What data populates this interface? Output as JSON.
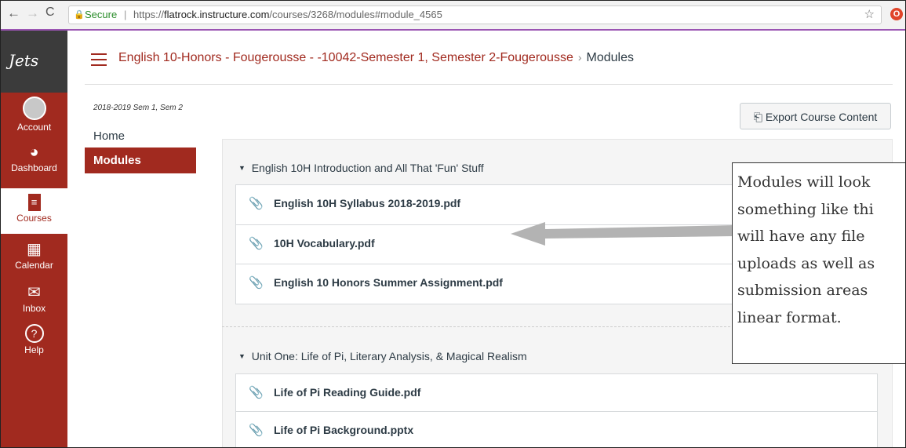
{
  "browser": {
    "secure_label": "Secure",
    "url_prefix": "https://",
    "url_host": "flatrock.instructure.com",
    "url_path": "/courses/3268/modules#module_4565"
  },
  "global_nav": {
    "logo": "Jets",
    "items": [
      {
        "label": "Account",
        "icon": "avatar-icon"
      },
      {
        "label": "Dashboard",
        "icon": "dashboard-icon"
      },
      {
        "label": "Courses",
        "icon": "courses-icon"
      },
      {
        "label": "Calendar",
        "icon": "calendar-icon"
      },
      {
        "label": "Inbox",
        "icon": "inbox-icon"
      },
      {
        "label": "Help",
        "icon": "help-icon"
      }
    ]
  },
  "breadcrumb": {
    "course": "English 10-Honors - Fougerousse - -10042-Semester 1, Semester 2-Fougerousse",
    "current": "Modules"
  },
  "course_nav": {
    "term": "2018-2019 Sem 1, Sem 2",
    "items": [
      "Home",
      "Modules"
    ]
  },
  "export_button": "Export Course Content",
  "modules": [
    {
      "title": "English 10H Introduction and All That 'Fun' Stuff",
      "items": [
        "English 10H Syllabus 2018-2019.pdf",
        "10H Vocabulary.pdf",
        "English 10 Honors Summer Assignment.pdf"
      ]
    },
    {
      "title": "Unit One: Life of Pi, Literary Analysis, & Magical Realism",
      "items": [
        "Life of Pi Reading Guide.pdf",
        "Life of Pi Background.pptx"
      ]
    }
  ],
  "annotation": {
    "lines": [
      "Modules will look",
      "something like thi",
      "will have any file",
      "uploads as well as",
      "submission areas",
      "linear format."
    ]
  },
  "colors": {
    "brand": "#a12a1f",
    "nav_dark": "#3b3b3b",
    "browser_accent": "#9b55b3"
  }
}
